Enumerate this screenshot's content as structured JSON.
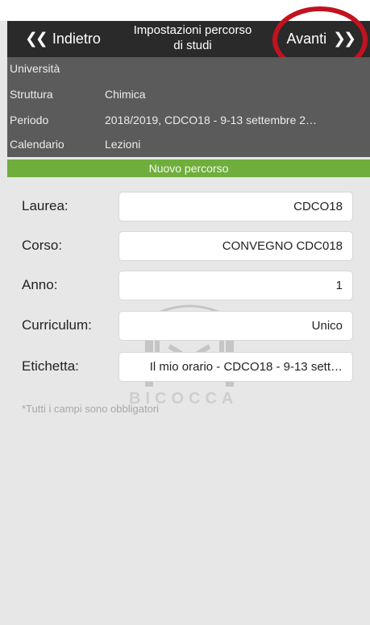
{
  "navbar": {
    "back_label": "Indietro",
    "title": "Impostazioni percorso di studi",
    "next_label": "Avanti"
  },
  "info": {
    "rows": [
      {
        "label": "Università",
        "value": ""
      },
      {
        "label": "Struttura",
        "value": "Chimica"
      },
      {
        "label": "Periodo",
        "value": "2018/2019, CDCO18 -  9-13 settembre 2…"
      },
      {
        "label": "Calendario",
        "value": "Lezioni"
      }
    ]
  },
  "banner": {
    "text": "Nuovo percorso"
  },
  "form": {
    "fields": [
      {
        "label": "Laurea:",
        "value": "CDCO18"
      },
      {
        "label": "Corso:",
        "value": "CONVEGNO CDC018"
      },
      {
        "label": "Anno:",
        "value": "1"
      },
      {
        "label": "Curriculum:",
        "value": "Unico"
      },
      {
        "label": "Etichetta:",
        "value": "Il mio orario - CDCO18 -  9-13 sett…"
      }
    ],
    "note": "*Tutti i campi sono obbligatori"
  },
  "watermark": {
    "text": "BICOCCA"
  },
  "colors": {
    "navbar": "#2a2a2a",
    "info_panel": "#5b5b5b",
    "banner": "#6fae3d",
    "highlight": "#c1121f",
    "background": "#e7e7e7"
  },
  "icons": {
    "back": "double-chevron-left-icon",
    "next": "double-chevron-right-icon"
  }
}
